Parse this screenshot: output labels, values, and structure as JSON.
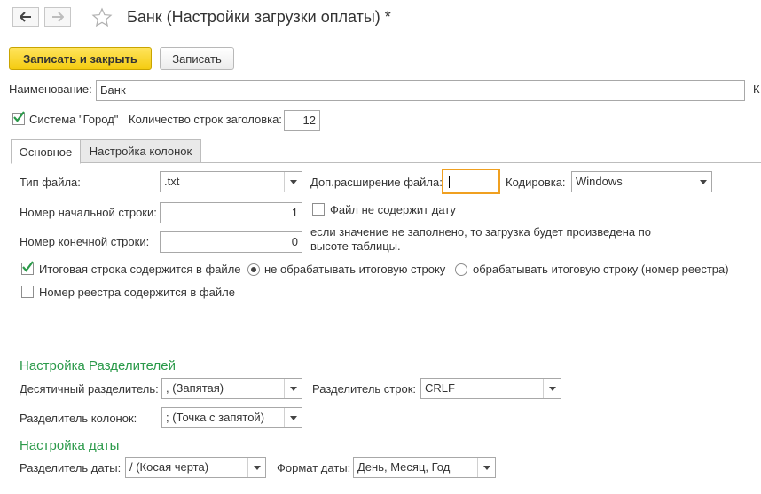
{
  "window": {
    "title": "Банк (Настройки загрузки оплаты) *",
    "nav_back_icon": "arrow-left-icon",
    "nav_forward_icon": "arrow-right-icon",
    "favorite_icon": "star-icon"
  },
  "toolbar": {
    "save_close_label": "Записать и закрыть",
    "save_label": "Записать"
  },
  "header": {
    "name_label": "Наименование:",
    "name_value": "Банк",
    "cut_label": "К",
    "system_label": "Система \"Город\"",
    "system_checked": true,
    "header_rows_label": "Количество строк заголовка:",
    "header_rows_value": "12"
  },
  "tabs": [
    {
      "label": "Основное",
      "active": true
    },
    {
      "label": "Настройка колонок",
      "active": false
    }
  ],
  "main": {
    "file_type_label": "Тип файла:",
    "file_type_value": ".txt",
    "ext_label": "Доп.расширение файла:",
    "ext_value": "",
    "encoding_label": "Кодировка:",
    "encoding_value": "Windows",
    "start_row_label": "Номер начальной строки:",
    "start_row_value": "1",
    "no_date_label": "Файл не содержит дату",
    "no_date_checked": false,
    "end_row_label": "Номер конечной строки:",
    "end_row_value": "0",
    "end_row_hint_line1": "если значение не заполнено, то загрузка будет произведена по",
    "end_row_hint_line2": "высоте таблицы.",
    "total_row_label": "Итоговая строка содержится в файле",
    "total_row_checked": true,
    "radio_no_process_label": "не обрабатывать итоговую строку",
    "radio_no_process_selected": true,
    "radio_process_label": "обрабатывать итоговую строку (номер реестра)",
    "radio_process_selected": false,
    "registry_label": "Номер реестра содержится в файле",
    "registry_checked": false
  },
  "separators": {
    "title": "Настройка Разделителей",
    "decimal_label": "Десятичный разделитель:",
    "decimal_value": ", (Запятая)",
    "row_sep_label": "Разделитель строк:",
    "row_sep_value": "CRLF",
    "col_sep_label": "Разделитель колонок:",
    "col_sep_value": "; (Точка с запятой)"
  },
  "date_settings": {
    "title": "Настройка даты",
    "date_sep_label": "Разделитель даты:",
    "date_sep_value": "/ (Косая черта)",
    "date_format_label": "Формат даты:",
    "date_format_value": "День, Месяц, Год"
  },
  "colors": {
    "accent_yellow": "#f4cc10",
    "section_green": "#2b9a4a",
    "focus_orange": "#f0a020"
  }
}
